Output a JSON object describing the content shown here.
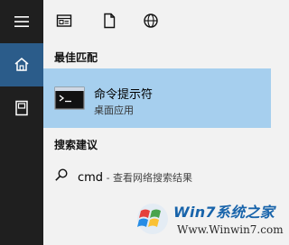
{
  "left_rail": {
    "items": [
      {
        "icon": "hamburger-icon"
      },
      {
        "icon": "home-icon"
      },
      {
        "icon": "document-icon"
      }
    ]
  },
  "top_tabs": [
    {
      "icon": "apps-icon"
    },
    {
      "icon": "documents-icon"
    },
    {
      "icon": "web-icon"
    }
  ],
  "best_match": {
    "heading": "最佳匹配",
    "app_name": "命令提示符",
    "app_type": "桌面应用"
  },
  "search_suggestions": {
    "heading": "搜索建议",
    "query": "cmd",
    "suffix": " - 查看网络搜索结果"
  },
  "watermark": {
    "brand": "Win7系统之家",
    "url": "Www.Winwin7.com"
  },
  "colors": {
    "rail_background": "#1f1f1f",
    "rail_selected": "#2b5c8a",
    "content_background": "#f2f2f2",
    "best_match_highlight": "#a6cfee",
    "watermark_blue": "#0f5ea8"
  }
}
